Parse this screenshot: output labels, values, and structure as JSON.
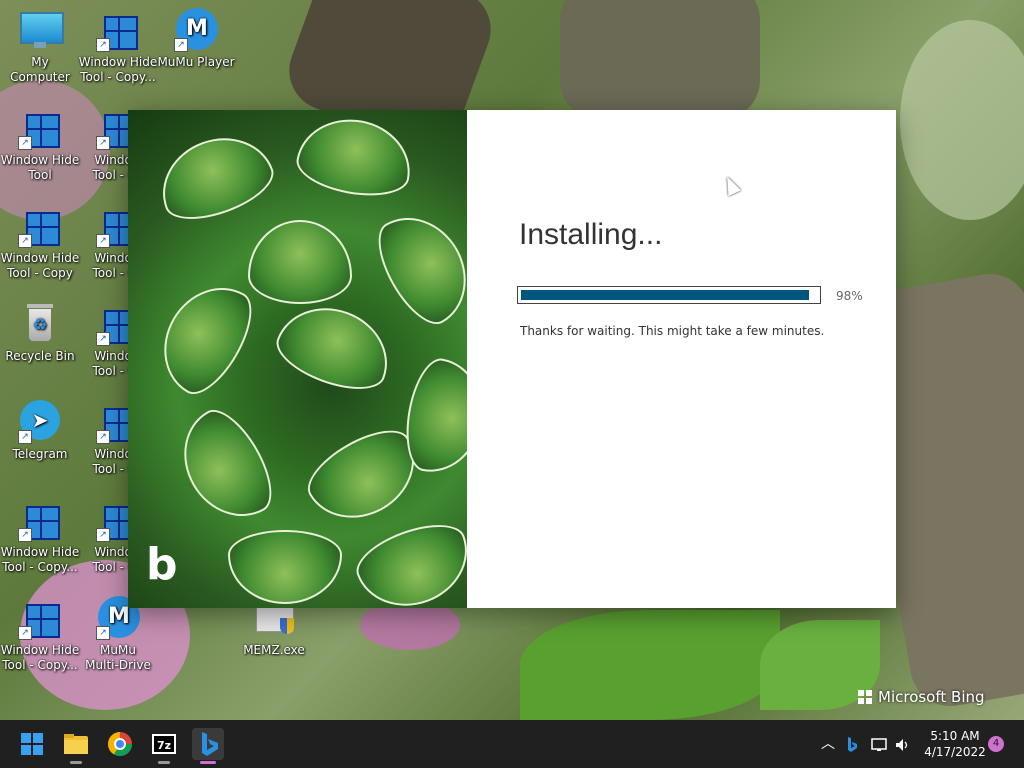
{
  "desktop": {
    "icons": [
      {
        "label": "My Computer"
      },
      {
        "label": "Window Hide\nTool - Copy..."
      },
      {
        "label": "MuMu Player"
      },
      {
        "label": "Window Hide\nTool"
      },
      {
        "label": "Window\nTool - Co"
      },
      {
        "label": "Window Hide\nTool - Copy"
      },
      {
        "label": "Window\nTool - Co"
      },
      {
        "label": "Recycle Bin"
      },
      {
        "label": "Window\nTool - Co"
      },
      {
        "label": "Telegram"
      },
      {
        "label": "Window\nTool - Co"
      },
      {
        "label": "Window Hide\nTool - Copy..."
      },
      {
        "label": "Window\nTool - Co"
      },
      {
        "label": "Window Hide\nTool - Copy..."
      },
      {
        "label": "MuMu\nMulti-Drive"
      },
      {
        "label": "MEMZ.exe"
      }
    ]
  },
  "installer": {
    "title": "Installing...",
    "progress_percent": 98,
    "progress_label": "98%",
    "message": "Thanks for waiting. This might take a few minutes.",
    "hero_logo": "b"
  },
  "wallpaper": {
    "brand": "Microsoft Bing"
  },
  "taskbar": {
    "apps": [
      {
        "icon": "windows-start-icon"
      },
      {
        "icon": "file-explorer-icon"
      },
      {
        "icon": "chrome-icon"
      },
      {
        "icon": "7zip-icon",
        "label": "7z"
      },
      {
        "icon": "bing-icon",
        "active": true
      }
    ],
    "tray": {
      "time": "5:10 AM",
      "date": "4/17/2022",
      "notification_count": "4"
    }
  },
  "colors": {
    "progress_fill": "#00577d",
    "taskbar_bg": "#202020",
    "active_indicator": "#d070d0"
  }
}
